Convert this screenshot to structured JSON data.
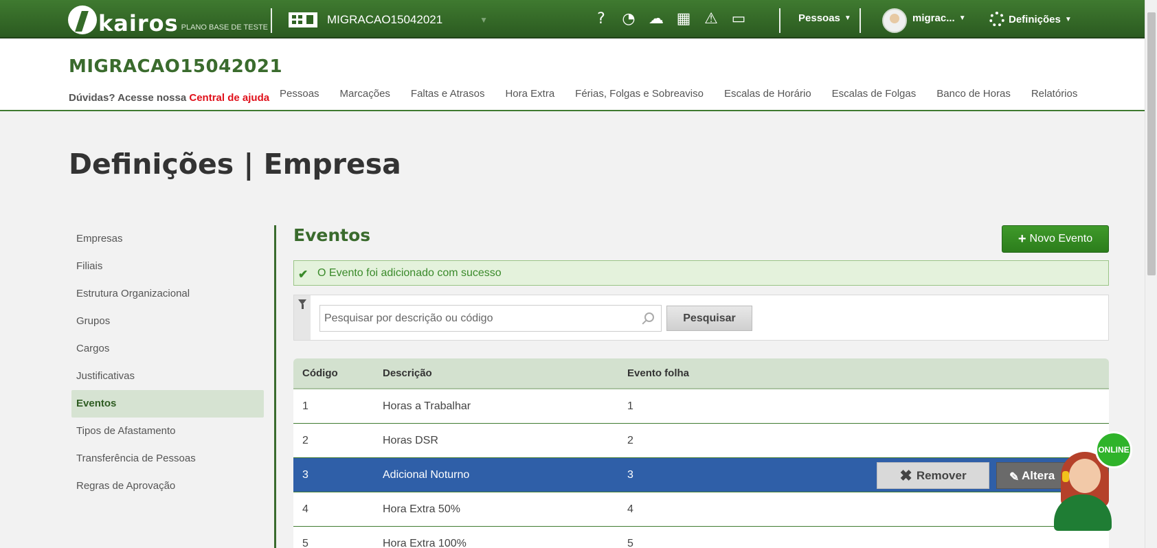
{
  "topbar": {
    "logo_text": "kairos",
    "logo_sub": "PLANO BASE DE TESTE",
    "company_name": "MIGRACAO15042021",
    "people_menu": "Pessoas",
    "user_name": "migrac...",
    "settings_menu": "Definições",
    "icons": [
      "help-icon",
      "dashboard-icon",
      "cloud-upload-icon",
      "calculator-icon",
      "warning-icon",
      "inbox-icon"
    ]
  },
  "header": {
    "company_title": "MIGRACAO15042021",
    "help_text": "Dúvidas? Acesse nossa",
    "help_link": "Central de ajuda",
    "nav": [
      "Pessoas",
      "Marcações",
      "Faltas e Atrasos",
      "Hora Extra",
      "Férias, Folgas e Sobreaviso",
      "Escalas de Horário",
      "Escalas de Folgas",
      "Banco de Horas",
      "Relatórios"
    ]
  },
  "page_title": "Definições | Empresa",
  "sidebar": {
    "items": [
      "Empresas",
      "Filiais",
      "Estrutura Organizacional",
      "Grupos",
      "Cargos",
      "Justificativas",
      "Eventos",
      "Tipos de Afastamento",
      "Transferência de Pessoas",
      "Regras de Aprovação"
    ],
    "active": "Eventos"
  },
  "content": {
    "section_title": "Eventos",
    "new_button": "Novo Evento",
    "alert": "O Evento foi adicionado com sucesso",
    "search_placeholder": "Pesquisar por descrição ou código",
    "search_button": "Pesquisar"
  },
  "table": {
    "columns": [
      "Código",
      "Descrição",
      "Evento folha"
    ],
    "rows": [
      [
        "1",
        "Horas a Trabalhar",
        "1"
      ],
      [
        "2",
        "Horas DSR",
        "2"
      ],
      [
        "3",
        "Adicional Noturno",
        "3"
      ],
      [
        "4",
        "Hora Extra 50%",
        "4"
      ],
      [
        "5",
        "Hora Extra 100%",
        "5"
      ]
    ],
    "selected_row": 2,
    "remove_button": "Remover",
    "edit_button": "Altera"
  },
  "chat": {
    "status": "ONLINE"
  },
  "colors": {
    "brand_green": "#3a6b2d",
    "selected_row": "#2f5fa8",
    "help_link": "#e0101a"
  }
}
